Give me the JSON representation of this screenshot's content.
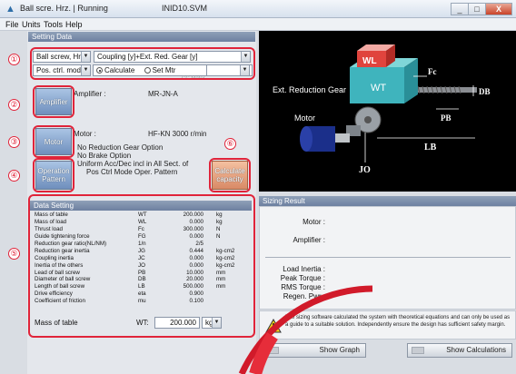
{
  "window": {
    "title": "Ball scre. Hrz. | Running",
    "file_name": "INID10.SVM",
    "controls": [
      "_",
      "□",
      "X"
    ]
  },
  "menu": [
    "File",
    "Units",
    "Tools",
    "Help"
  ],
  "left": {
    "header": "Setting Data",
    "mechanism_select": "Ball screw, Hrz.",
    "coupling_select": "Coupling [y]+Ext. Red. Gear [y]",
    "mode_select": "Pos. ctrl. mode",
    "radio_calculate": "Calculate",
    "radio_set_mtr": "Set Mtr",
    "cc_motor": "CC Motor",
    "buttons": {
      "amplifier": "Amplifier",
      "motor": "Motor",
      "operation": "Operation Pattern",
      "calculate_capacity": "Calculate capacity"
    },
    "amplifier_label": "Amplifier :",
    "amplifier_value": "MR-JN-A",
    "motor_label": "Motor :",
    "motor_value": "HF-KN  3000 r/min",
    "options": [
      "No Reduction Gear Option",
      "No Brake Option",
      "Uniform Acc/Dec incl in All Sect. of",
      "Pos Ctrl Mode Oper. Pattern"
    ]
  },
  "data_setting": {
    "header": "Data Setting",
    "rows": [
      {
        "name": "Mass of table",
        "sym": "WT",
        "val": "200.000",
        "unit": "kg"
      },
      {
        "name": "Mass of load",
        "sym": "WL",
        "val": "0.000",
        "unit": "kg"
      },
      {
        "name": "Thrust load",
        "sym": "Fc",
        "val": "300.000",
        "unit": "N"
      },
      {
        "name": "Guide tightening force",
        "sym": "FG",
        "val": "0.000",
        "unit": "N"
      },
      {
        "name": "Reduction gear ratio(NL/NM)",
        "sym": "1/n",
        "val": "2/5",
        "unit": ""
      },
      {
        "name": "Reduction gear inertia",
        "sym": "JG",
        "val": "0.444",
        "unit": "kg-cm2"
      },
      {
        "name": "Coupling inertia",
        "sym": "JC",
        "val": "0.000",
        "unit": "kg-cm2"
      },
      {
        "name": "Inertia of the others",
        "sym": "JO",
        "val": "0.000",
        "unit": "kg-cm2"
      },
      {
        "name": "Lead of ball screw",
        "sym": "PB",
        "val": "10.000",
        "unit": "mm"
      },
      {
        "name": "Diameter of ball screw",
        "sym": "DB",
        "val": "20.000",
        "unit": "mm"
      },
      {
        "name": "Length of ball screw",
        "sym": "LB",
        "val": "500.000",
        "unit": "mm"
      },
      {
        "name": "Drive efficiency",
        "sym": "eta",
        "val": "0.900",
        "unit": ""
      },
      {
        "name": "Coefficient of friction",
        "sym": "mu",
        "val": "0.100",
        "unit": ""
      }
    ],
    "edit_label": "Mass of table",
    "edit_sym": "WT:",
    "edit_value": "200.000",
    "edit_unit": "kg"
  },
  "diagram": {
    "wl": "WL",
    "wt": "WT",
    "fc": "Fc",
    "db": "DB",
    "pb": "PB",
    "lb": "LB",
    "jo": "JO",
    "gear": "Ext. Reduction Gear",
    "motor": "Motor"
  },
  "sizing": {
    "header": "Sizing Result",
    "motor": "Motor :",
    "amplifier": "Amplifier :",
    "load_inertia": "Load Inertia :",
    "peak_torque": "Peak Torque :",
    "rms_torque": "RMS Torque :",
    "regen_pwr": "Regen. Pwr :",
    "warning": "The sizing software calculated the system with theoretical equations and can only be used as a guide to a suitable solution. Independently ensure the design has sufficient safety margin.",
    "show_graph": "Show Graph",
    "show_calculations": "Show Calculations"
  },
  "annotations": [
    "①",
    "②",
    "③",
    "④",
    "⑤",
    "⑥"
  ],
  "colors": {
    "annotation": "#e0243a",
    "panel_header": "#7689a8",
    "orange_button": "#d98a66"
  }
}
